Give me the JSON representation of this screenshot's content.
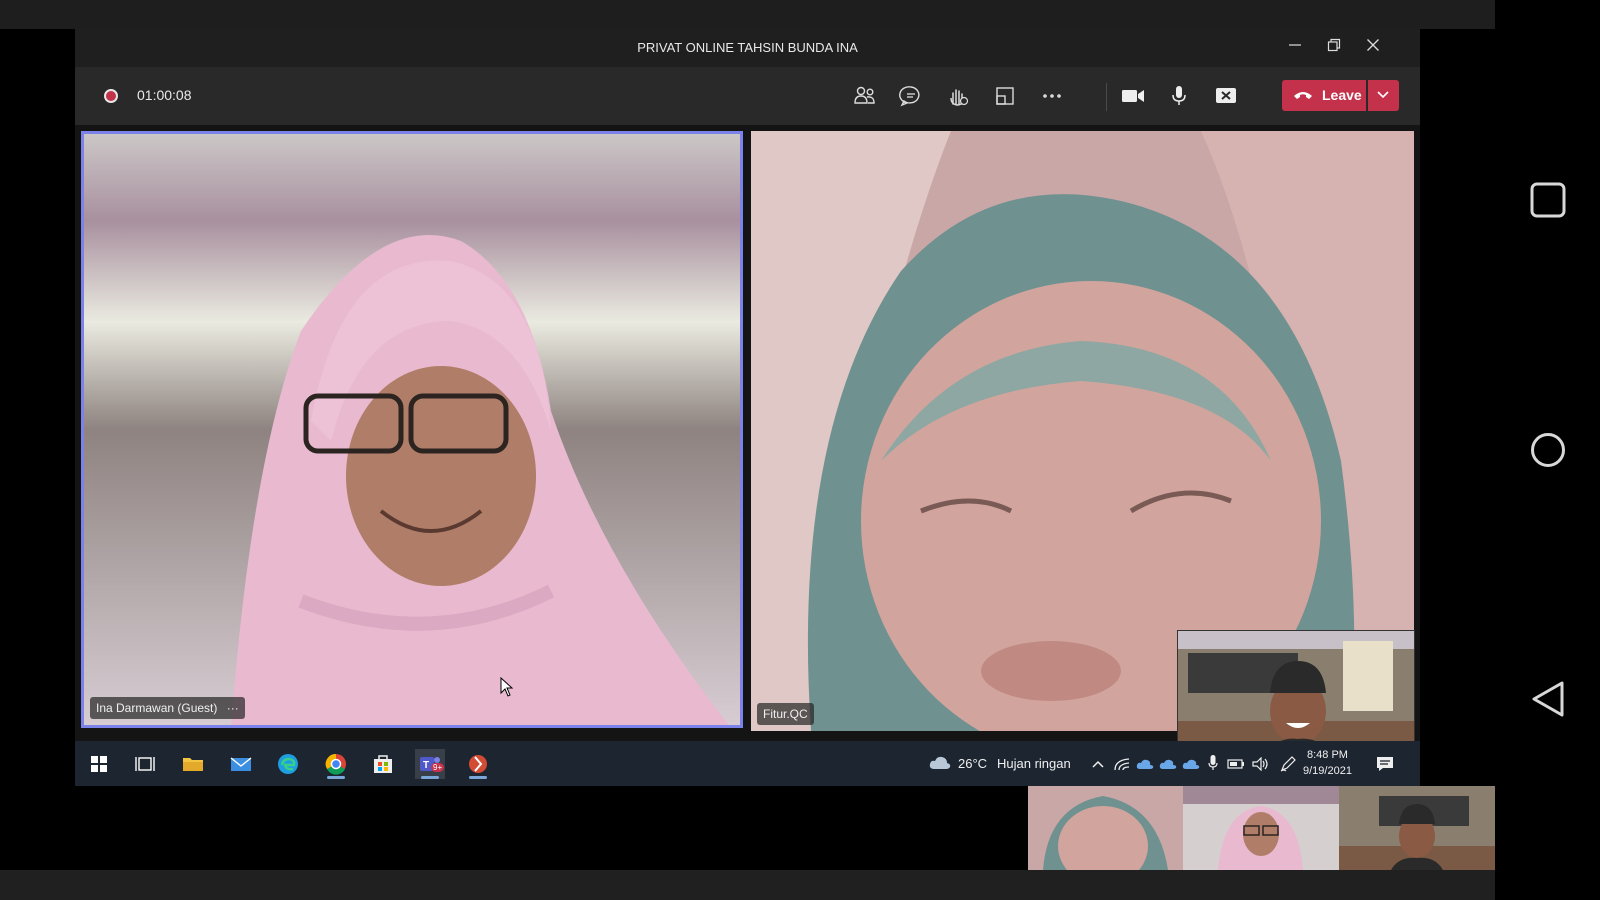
{
  "window": {
    "title": "PRIVAT ONLINE TAHSIN BUNDA INA"
  },
  "toolbar": {
    "timer": "01:00:08",
    "leave_label": "Leave"
  },
  "participants": {
    "left_name": "Ina Darmawan (Guest)",
    "left_more": "···",
    "right_name": "Fitur.QC"
  },
  "taskbar": {
    "temperature": "26°C",
    "weather": "Hujan ringan",
    "time": "8:48 PM",
    "date": "9/19/2021",
    "teams_badge": "9+"
  },
  "colors": {
    "accent_leave": "#c4314b",
    "speaker_border": "#7b83eb",
    "record_dot": "#c4314b"
  }
}
